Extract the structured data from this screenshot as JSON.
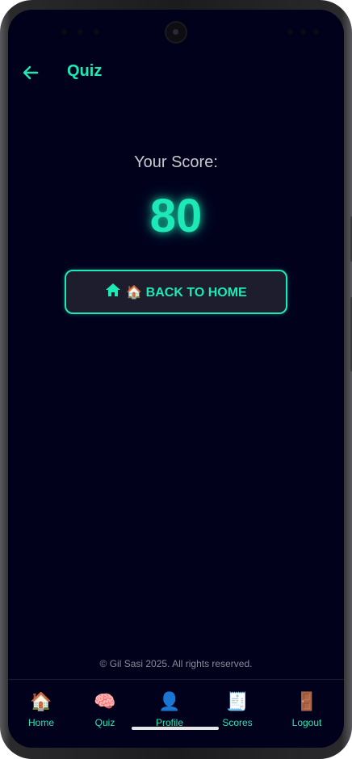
{
  "app_bar": {
    "title": "Quiz"
  },
  "score": {
    "label": "Your Score:",
    "value": "80"
  },
  "back_home_button": {
    "label": "🏠 BACK TO HOME",
    "icon": "home-icon"
  },
  "footer": {
    "copyright": "© Gil Sasi 2025. All rights reserved."
  },
  "bottom_nav": {
    "items": [
      {
        "label": "Home",
        "icon": "🏠"
      },
      {
        "label": "Quiz",
        "icon": "🧠"
      },
      {
        "label": "Profile",
        "icon": "👤"
      },
      {
        "label": "Scores",
        "icon": "🧾"
      },
      {
        "label": "Logout",
        "icon": "🚪"
      }
    ]
  },
  "colors": {
    "background": "#01011c",
    "accent": "#1de9b6",
    "button_bg": "#1d1d2e",
    "label_gray": "#c8c8cc"
  }
}
